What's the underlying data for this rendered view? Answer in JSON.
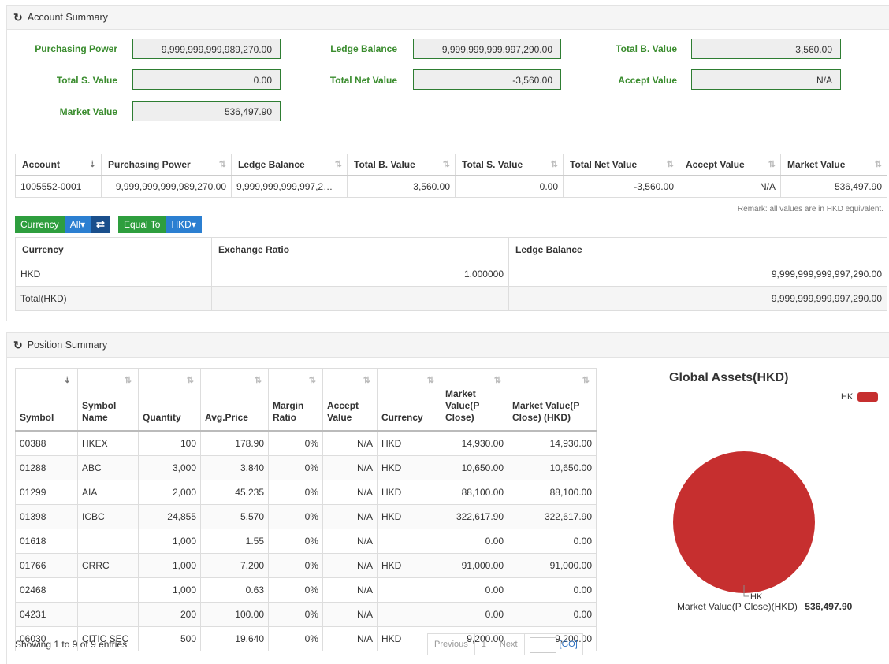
{
  "account_summary": {
    "title": "Account Summary",
    "fields": {
      "purchasing_power": {
        "label": "Purchasing Power",
        "value": "9,999,999,999,989,270.00"
      },
      "ledge_balance": {
        "label": "Ledge Balance",
        "value": "9,999,999,999,997,290.00"
      },
      "total_b_value": {
        "label": "Total B. Value",
        "value": "3,560.00"
      },
      "total_s_value": {
        "label": "Total S. Value",
        "value": "0.00"
      },
      "total_net_value": {
        "label": "Total Net Value",
        "value": "-3,560.00"
      },
      "accept_value": {
        "label": "Accept Value",
        "value": "N/A"
      },
      "market_value": {
        "label": "Market Value",
        "value": "536,497.90"
      }
    },
    "table": {
      "headers": [
        "Account",
        "Purchasing Power",
        "Ledge Balance",
        "Total B. Value",
        "Total S. Value",
        "Total Net Value",
        "Accept Value",
        "Market Value"
      ],
      "row": [
        "1005552-0001",
        "9,999,999,999,989,270.00",
        "9,999,999,999,997,2…",
        "3,560.00",
        "0.00",
        "-3,560.00",
        "N/A",
        "536,497.90"
      ]
    },
    "remark": "Remark: all values are in HKD equivalent.",
    "filters": {
      "currency_label": "Currency",
      "currency_value": "All▾",
      "swap_icon": "⇄",
      "equal_to_label": "Equal To",
      "equal_to_value": "HKD▾"
    },
    "currency_table": {
      "headers": [
        "Currency",
        "Exchange Ratio",
        "Ledge Balance"
      ],
      "rows": [
        [
          "HKD",
          "1.000000",
          "9,999,999,999,997,290.00"
        ],
        [
          "Total(HKD)",
          "",
          "9,999,999,999,997,290.00"
        ]
      ]
    }
  },
  "position_summary": {
    "title": "Position Summary",
    "headers": [
      "Symbol",
      "Symbol Name",
      "Quantity",
      "Avg.Price",
      "Margin Ratio",
      "Accept Value",
      "Currency",
      "Market Value(P Close)",
      "Market Value(P Close) (HKD)"
    ],
    "rows": [
      [
        "00388",
        "HKEX",
        "100",
        "178.90",
        "0%",
        "N/A",
        "HKD",
        "14,930.00",
        "14,930.00"
      ],
      [
        "01288",
        "ABC",
        "3,000",
        "3.840",
        "0%",
        "N/A",
        "HKD",
        "10,650.00",
        "10,650.00"
      ],
      [
        "01299",
        "AIA",
        "2,000",
        "45.235",
        "0%",
        "N/A",
        "HKD",
        "88,100.00",
        "88,100.00"
      ],
      [
        "01398",
        "ICBC",
        "24,855",
        "5.570",
        "0%",
        "N/A",
        "HKD",
        "322,617.90",
        "322,617.90"
      ],
      [
        "01618",
        "",
        "1,000",
        "1.55",
        "0%",
        "N/A",
        "",
        "0.00",
        "0.00"
      ],
      [
        "01766",
        "CRRC",
        "1,000",
        "7.200",
        "0%",
        "N/A",
        "HKD",
        "91,000.00",
        "91,000.00"
      ],
      [
        "02468",
        "",
        "1,000",
        "0.63",
        "0%",
        "N/A",
        "",
        "0.00",
        "0.00"
      ],
      [
        "04231",
        "",
        "200",
        "100.00",
        "0%",
        "N/A",
        "",
        "0.00",
        "0.00"
      ],
      [
        "06030",
        "CITIC SEC",
        "500",
        "19.640",
        "0%",
        "N/A",
        "HKD",
        "9,200.00",
        "9,200.00"
      ]
    ],
    "showing": "Showing 1 to 9 of 9 entries",
    "pager": {
      "previous": "Previous",
      "page": "1",
      "next": "Next",
      "go": "[GO]"
    }
  },
  "chart_data": {
    "type": "pie",
    "title": "Global Assets(HKD)",
    "categories": [
      "HK"
    ],
    "values": [
      536497.9
    ],
    "colors": [
      "#c62f2f"
    ],
    "legend": "top-right",
    "slice_labels": [
      "HK"
    ]
  },
  "chart_footer": {
    "label": "Market Value(P Close)(HKD)",
    "value": "536,497.90"
  },
  "icons": {
    "refresh": "↻",
    "sort": "⇅",
    "sort_active": "⇣"
  }
}
